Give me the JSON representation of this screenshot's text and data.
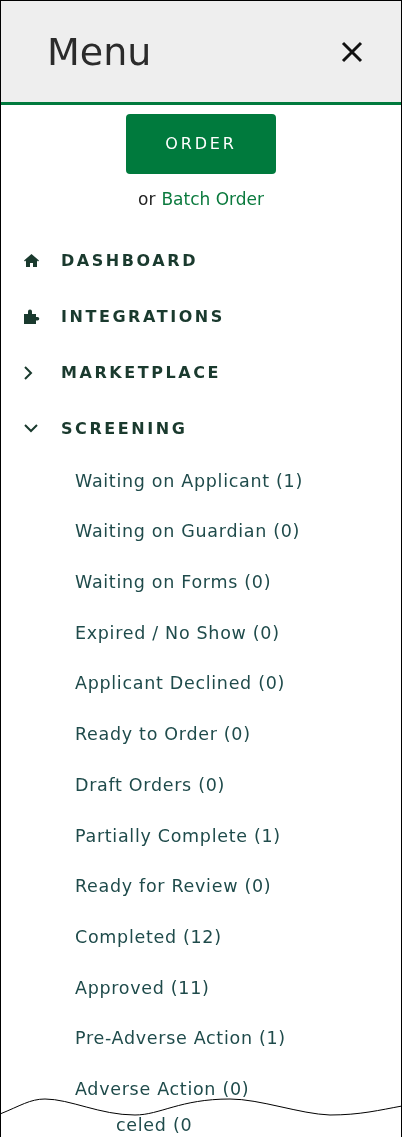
{
  "header": {
    "title": "Menu"
  },
  "order_button": "ORDER",
  "batch": {
    "prefix": "or",
    "link": "Batch Order"
  },
  "nav": [
    {
      "kind": "link",
      "label": "DASHBOARD"
    },
    {
      "kind": "link",
      "label": "INTEGRATIONS"
    },
    {
      "kind": "group",
      "label": "MARKETPLACE",
      "expanded": false
    },
    {
      "kind": "group",
      "label": "SCREENING",
      "expanded": true,
      "children": [
        {
          "label": "Waiting on Applicant (1)"
        },
        {
          "label": "Waiting on Guardian (0)"
        },
        {
          "label": "Waiting on Forms (0)"
        },
        {
          "label": "Expired / No Show (0)"
        },
        {
          "label": "Applicant Declined (0)"
        },
        {
          "label": "Ready to Order (0)"
        },
        {
          "label": "Draft Orders (0)"
        },
        {
          "label": "Partially Complete (1)"
        },
        {
          "label": "Ready for Review (0)"
        },
        {
          "label": "Completed (12)"
        },
        {
          "label": "Approved (11)"
        },
        {
          "label": "Pre-Adverse Action (1)"
        },
        {
          "label": "Adverse Action (0)"
        },
        {
          "label": "celed (0"
        }
      ]
    }
  ]
}
